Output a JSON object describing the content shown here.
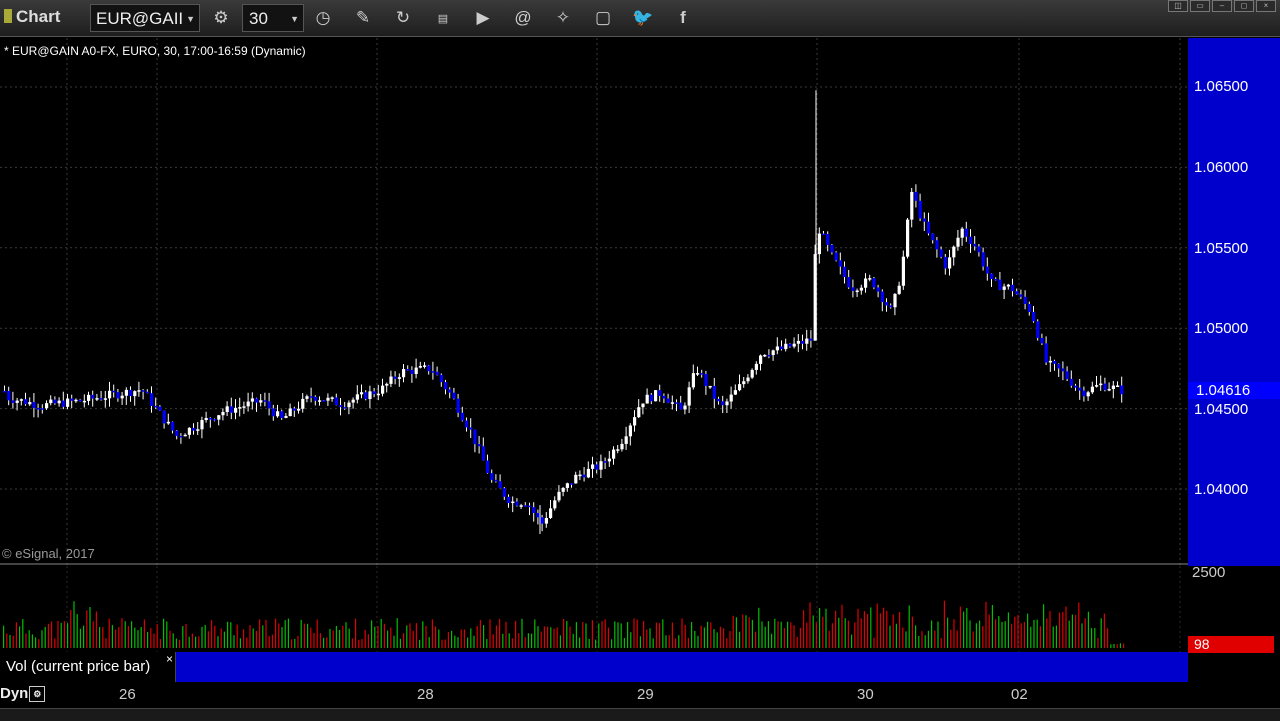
{
  "toolbar": {
    "app_title": "Chart",
    "symbol": "EUR@GAII",
    "interval": "30",
    "icons": [
      "link-icon",
      "clock-icon",
      "draw-icon",
      "refresh-icon",
      "get-icon",
      "play-icon",
      "alert-icon",
      "tool-icon",
      "chat-icon",
      "twitter-icon",
      "facebook-icon"
    ]
  },
  "chart": {
    "header": "* EUR@GAIN A0-FX, EURO, 30, 17:00-16:59 (Dynamic)",
    "copyright": "© eSignal, 2017",
    "last_price": "1.04616",
    "price_labels": [
      "1.06500",
      "1.06000",
      "1.05500",
      "1.05000",
      "1.04500",
      "1.04000"
    ],
    "price_values": [
      1.065,
      1.06,
      1.055,
      1.05,
      1.045,
      1.04
    ],
    "volume_max": "2500",
    "volume_current": "98",
    "volume_study_label": "Vol (current price bar)",
    "close_mark": "×",
    "time_labels": [
      "26",
      "28",
      "29",
      "30",
      "02"
    ],
    "dyn_label": "Dyn",
    "colors": {
      "up": "#ffffff",
      "down": "#0000ff",
      "axis": "#0000cc",
      "vol_up": "#00c000",
      "vol_down": "#e00000"
    }
  }
}
